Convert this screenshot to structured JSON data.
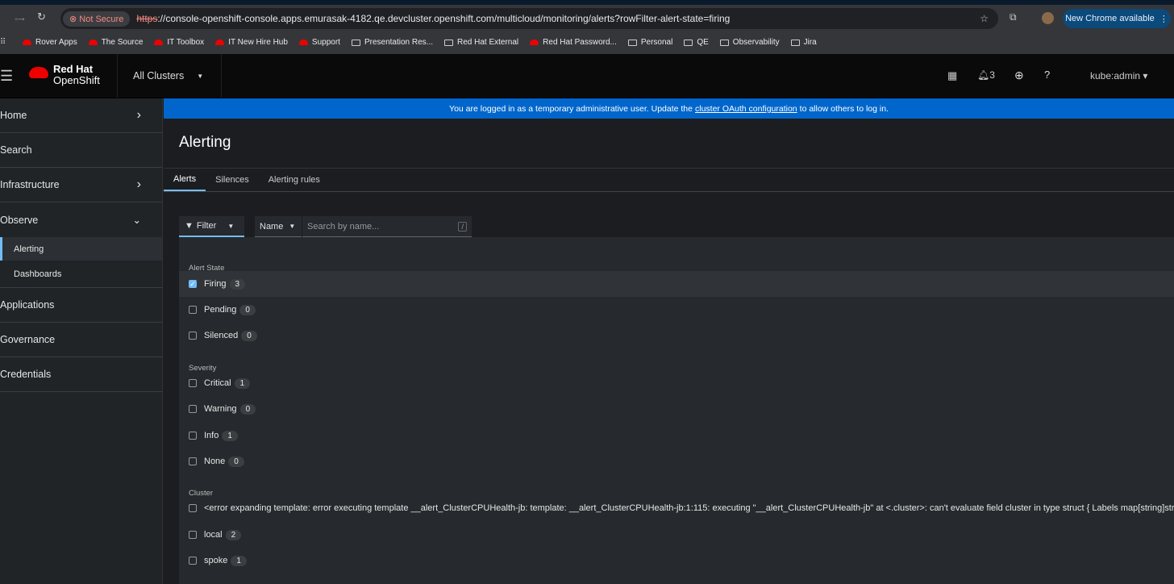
{
  "browser": {
    "nav_back": "←",
    "nav_forward": "→",
    "reload": "↻",
    "not_secure": "Not Secure",
    "url_scheme": "https",
    "url_rest": "://console-openshift-console.apps.emurasak-4182.qe.devcluster.openshift.com/multicloud/monitoring/alerts?rowFilter-alert-state=firing",
    "new_chrome": "New Chrome available",
    "bookmarks": [
      {
        "label": "Rover Apps",
        "icon": "redhat"
      },
      {
        "label": "The Source",
        "icon": "redhat"
      },
      {
        "label": "IT Toolbox",
        "icon": "redhat"
      },
      {
        "label": "IT New Hire Hub",
        "icon": "redhat"
      },
      {
        "label": "Support",
        "icon": "redhat"
      },
      {
        "label": "Presentation Res...",
        "icon": "folder"
      },
      {
        "label": "Red Hat External",
        "icon": "folder"
      },
      {
        "label": "Red Hat Password...",
        "icon": "redhat"
      },
      {
        "label": "Personal",
        "icon": "folder"
      },
      {
        "label": "QE",
        "icon": "folder"
      },
      {
        "label": "Observability",
        "icon": "folder"
      },
      {
        "label": "Jira",
        "icon": "folder"
      }
    ]
  },
  "masthead": {
    "brand_line1": "Red Hat",
    "brand_line2": "OpenShift",
    "cluster_selector": "All Clusters",
    "notifications_count": "3",
    "user": "kube:admin"
  },
  "sidebar": {
    "items": [
      {
        "label": "Home",
        "chevron": "›"
      },
      {
        "label": "Search",
        "chevron": ""
      },
      {
        "label": "Infrastructure",
        "chevron": "›"
      },
      {
        "label": "Observe",
        "chevron": "⌄"
      }
    ],
    "observe_sub": [
      "Alerting",
      "Dashboards"
    ],
    "items_after": [
      "Applications",
      "Governance",
      "Credentials"
    ]
  },
  "banner": {
    "before": "You are logged in as a temporary administrative user. Update the",
    "link": "cluster OAuth configuration",
    "after": "to allow others to log in."
  },
  "page": {
    "title": "Alerting",
    "tabs": [
      "Alerts",
      "Silences",
      "Alerting rules"
    ]
  },
  "toolbar": {
    "filter": "Filter",
    "name": "Name",
    "search_placeholder": "Search by name...",
    "shortcut": "/"
  },
  "filters": {
    "alert_state": {
      "label": "Alert State",
      "options": [
        {
          "label": "Firing",
          "count": "3",
          "checked": true
        },
        {
          "label": "Pending",
          "count": "0",
          "checked": false
        },
        {
          "label": "Silenced",
          "count": "0",
          "checked": false
        }
      ]
    },
    "severity": {
      "label": "Severity",
      "options": [
        {
          "label": "Critical",
          "count": "1"
        },
        {
          "label": "Warning",
          "count": "0"
        },
        {
          "label": "Info",
          "count": "1"
        },
        {
          "label": "None",
          "count": "0"
        }
      ]
    },
    "cluster": {
      "label": "Cluster",
      "options": [
        {
          "label": "<error expanding template: error executing template __alert_ClusterCPUHealth-jb: template: __alert_ClusterCPUHealth-jb:1:115: executing \"__alert_ClusterCPUHealth-jb\" at <.cluster>: can't evaluate field cluster in type struct { Labels map[string]string; E"
        },
        {
          "label": "local",
          "count": "2"
        },
        {
          "label": "spoke",
          "count": "1"
        }
      ]
    }
  }
}
